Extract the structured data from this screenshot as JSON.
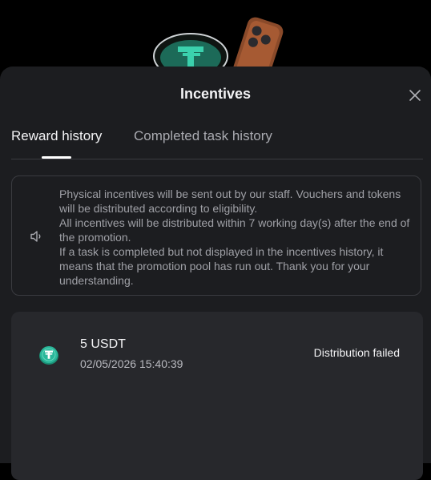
{
  "header": {
    "title": "Incentives"
  },
  "tabs": [
    {
      "label": "Reward history",
      "active": true
    },
    {
      "label": "Completed task history",
      "active": false
    }
  ],
  "notice": {
    "icon": "speaker-icon",
    "lines": [
      "Physical incentives will be sent out by our staff. Vouchers and tokens will be distributed according to eligibility.",
      "All incentives will be distributed within 7 working day(s) after the end of the promotion.",
      "If a task is completed but not displayed in the incentives history, it means that the promotion pool has run out. Thank you for your understanding."
    ]
  },
  "rewards": [
    {
      "icon": "usdt-coin-icon",
      "name": "5 USDT",
      "timestamp": "02/05/2026 15:40:39",
      "status": "Distribution failed"
    }
  ],
  "colors": {
    "background": "#000000",
    "sheet": "#1c1d20",
    "card": "#27282c",
    "accent": "#2ab79a"
  }
}
